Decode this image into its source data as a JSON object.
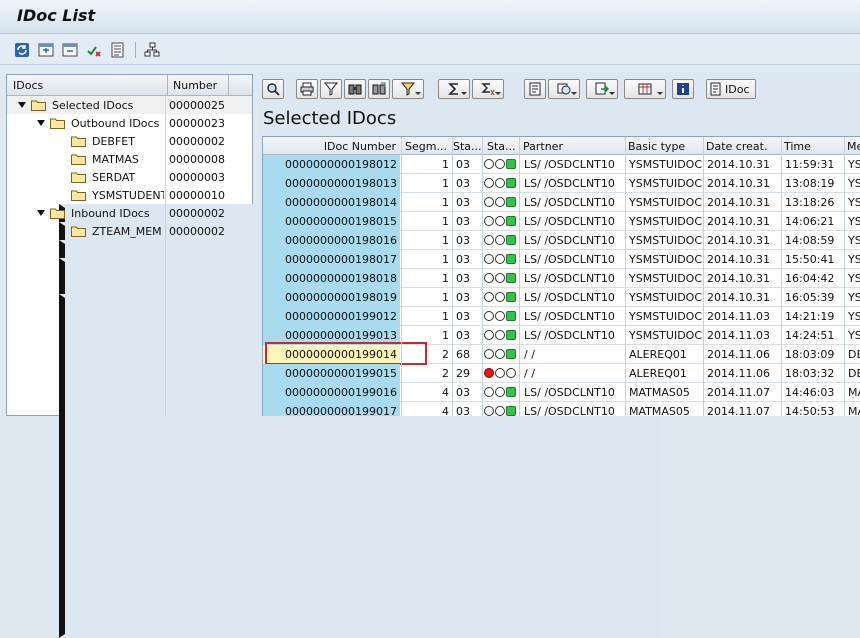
{
  "window": {
    "title": "IDoc List"
  },
  "toolbar": {
    "icons": [
      "refresh-icon",
      "expand-icon",
      "collapse-icon",
      "process-icon",
      "details-icon",
      "hierarchy-icon"
    ]
  },
  "tree": {
    "col_idocs": "IDocs",
    "col_number": "Number",
    "rows": [
      {
        "label": "Selected IDocs",
        "number": "00000025",
        "expanded": true
      },
      {
        "label": "Outbound IDocs",
        "number": "00000023",
        "expanded": true
      },
      {
        "label": "DEBFET",
        "number": "00000002",
        "expanded": false
      },
      {
        "label": "MATMAS",
        "number": "00000008",
        "expanded": false
      },
      {
        "label": "SERDAT",
        "number": "00000003",
        "expanded": false
      },
      {
        "label": "YSMSTUDENT",
        "number": "00000010",
        "expanded": false
      },
      {
        "label": "Inbound IDocs",
        "number": "00000002",
        "expanded": true
      },
      {
        "label": "ZTEAM_MEM",
        "number": "00000002",
        "expanded": false
      }
    ]
  },
  "alv": {
    "section_title": "Selected IDocs",
    "idoc_button": "IDoc",
    "columns": [
      "IDoc Number",
      "Segm...",
      "Sta...",
      "Sta...",
      "Partner",
      "Basic type",
      "Date creat.",
      "Time",
      "Me"
    ],
    "rows": [
      {
        "idoc": "0000000000198012",
        "segm": "1",
        "status": "03",
        "lights": "green",
        "partner": "LS/  /OSDCLNT10",
        "basic": "YSMSTUIDOC",
        "date": "2014.10.31",
        "time": "11:59:31",
        "me": "YS"
      },
      {
        "idoc": "0000000000198013",
        "segm": "1",
        "status": "03",
        "lights": "green",
        "partner": "LS/  /OSDCLNT10",
        "basic": "YSMSTUIDOC",
        "date": "2014.10.31",
        "time": "13:08:19",
        "me": "YS"
      },
      {
        "idoc": "0000000000198014",
        "segm": "1",
        "status": "03",
        "lights": "green",
        "partner": "LS/  /OSDCLNT10",
        "basic": "YSMSTUIDOC",
        "date": "2014.10.31",
        "time": "13:18:26",
        "me": "YS"
      },
      {
        "idoc": "0000000000198015",
        "segm": "1",
        "status": "03",
        "lights": "green",
        "partner": "LS/  /OSDCLNT10",
        "basic": "YSMSTUIDOC",
        "date": "2014.10.31",
        "time": "14:06:21",
        "me": "YS"
      },
      {
        "idoc": "0000000000198016",
        "segm": "1",
        "status": "03",
        "lights": "green",
        "partner": "LS/  /OSDCLNT10",
        "basic": "YSMSTUIDOC",
        "date": "2014.10.31",
        "time": "14:08:59",
        "me": "YS"
      },
      {
        "idoc": "0000000000198017",
        "segm": "1",
        "status": "03",
        "lights": "green",
        "partner": "LS/  /OSDCLNT10",
        "basic": "YSMSTUIDOC",
        "date": "2014.10.31",
        "time": "15:50:41",
        "me": "YS"
      },
      {
        "idoc": "0000000000198018",
        "segm": "1",
        "status": "03",
        "lights": "green",
        "partner": "LS/  /OSDCLNT10",
        "basic": "YSMSTUIDOC",
        "date": "2014.10.31",
        "time": "16:04:42",
        "me": "YS"
      },
      {
        "idoc": "0000000000198019",
        "segm": "1",
        "status": "03",
        "lights": "green",
        "partner": "LS/  /OSDCLNT10",
        "basic": "YSMSTUIDOC",
        "date": "2014.10.31",
        "time": "16:05:39",
        "me": "YS"
      },
      {
        "idoc": "0000000000199012",
        "segm": "1",
        "status": "03",
        "lights": "green",
        "partner": "LS/  /OSDCLNT10",
        "basic": "YSMSTUIDOC",
        "date": "2014.11.03",
        "time": "14:21:19",
        "me": "YS"
      },
      {
        "idoc": "0000000000199013",
        "segm": "1",
        "status": "03",
        "lights": "green",
        "partner": "LS/  /OSDCLNT10",
        "basic": "YSMSTUIDOC",
        "date": "2014.11.03",
        "time": "14:24:51",
        "me": "YS"
      },
      {
        "idoc": "0000000000199014",
        "segm": "2",
        "status": "68",
        "lights": "green",
        "partner": "/ /",
        "basic": "ALEREQ01",
        "date": "2014.11.06",
        "time": "18:03:09",
        "me": "DE",
        "highlight": true
      },
      {
        "idoc": "0000000000199015",
        "segm": "2",
        "status": "29",
        "lights": "red",
        "partner": "/ /",
        "basic": "ALEREQ01",
        "date": "2014.11.06",
        "time": "18:03:32",
        "me": "DE"
      },
      {
        "idoc": "0000000000199016",
        "segm": "4",
        "status": "03",
        "lights": "green",
        "partner": "LS/  /OSDCLNT10",
        "basic": "MATMAS05",
        "date": "2014.11.07",
        "time": "14:46:03",
        "me": "MA"
      },
      {
        "idoc": "0000000000199017",
        "segm": "4",
        "status": "03",
        "lights": "green",
        "partner": "LS/  /OSDCLNT10",
        "basic": "MATMAS05",
        "date": "2014.11.07",
        "time": "14:50:53",
        "me": "MA"
      }
    ]
  },
  "colors": {
    "key_column": "#a9dbee",
    "highlight_cell": "#fff5b8",
    "highlight_border": "#d0262e",
    "status_green": "#33c24a",
    "status_red": "#e31818"
  }
}
